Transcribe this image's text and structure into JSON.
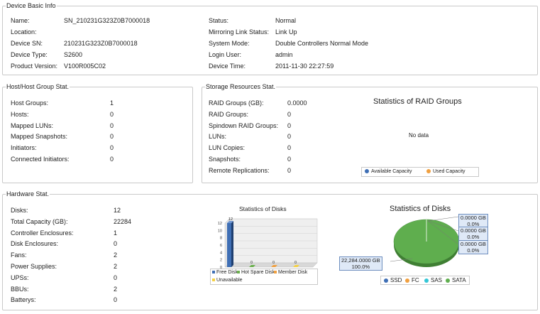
{
  "basic": {
    "legend": "Device Basic Info",
    "left": [
      {
        "label": "Name:",
        "value": "SN_210231G323Z0B7000018"
      },
      {
        "label": "Location:",
        "value": ""
      },
      {
        "label": "Device SN:",
        "value": "210231G323Z0B7000018"
      },
      {
        "label": "Device Type:",
        "value": "S2600"
      },
      {
        "label": "Product Version:",
        "value": "V100R005C02"
      }
    ],
    "right": [
      {
        "label": "Status:",
        "value": "Normal"
      },
      {
        "label": "Mirroring Link Status:",
        "value": "Link Up"
      },
      {
        "label": "System Mode:",
        "value": "Double Controllers Normal Mode"
      },
      {
        "label": "Login User:",
        "value": "admin"
      },
      {
        "label": "Device Time:",
        "value": "2011-11-30 22:27:59"
      }
    ]
  },
  "host": {
    "legend": "Host/Host Group Stat.",
    "rows": [
      {
        "label": "Host Groups:",
        "value": "1"
      },
      {
        "label": "Hosts:",
        "value": "0"
      },
      {
        "label": "Mapped LUNs:",
        "value": "0"
      },
      {
        "label": "Mapped Snapshots:",
        "value": "0"
      },
      {
        "label": "Initiators:",
        "value": "0"
      },
      {
        "label": "Connected Initiators:",
        "value": "0"
      }
    ]
  },
  "storage": {
    "legend": "Storage Resources Stat.",
    "rows": [
      {
        "label": "RAID Groups (GB):",
        "value": "0.0000"
      },
      {
        "label": "RAID Groups:",
        "value": "0"
      },
      {
        "label": "Spindown RAID Groups:",
        "value": "0"
      },
      {
        "label": "LUNs:",
        "value": "0"
      },
      {
        "label": "LUN Copies:",
        "value": "0"
      },
      {
        "label": "Snapshots:",
        "value": "0"
      },
      {
        "label": "Remote Replications:",
        "value": "0"
      }
    ],
    "raid_chart_title": "Statistics of RAID Groups",
    "raid_no_data": "No data",
    "raid_legend": [
      {
        "name": "Available Capacity",
        "color": "#3f6fb5"
      },
      {
        "name": "Used Capacity",
        "color": "#f0a040"
      }
    ]
  },
  "hardware": {
    "legend": "Hardware Stat.",
    "rows": [
      {
        "label": "Disks:",
        "value": "12"
      },
      {
        "label": "Total Capacity (GB):",
        "value": "22284"
      },
      {
        "label": "Controller Enclosures:",
        "value": "1"
      },
      {
        "label": "Disk Enclosures:",
        "value": "0"
      },
      {
        "label": "Fans:",
        "value": "2"
      },
      {
        "label": "Power Supplies:",
        "value": "2"
      },
      {
        "label": "UPSs:",
        "value": "0"
      },
      {
        "label": "BBUs:",
        "value": "2"
      },
      {
        "label": "Batterys:",
        "value": "0"
      }
    ]
  },
  "chart_data": [
    {
      "type": "bar",
      "title": "Statistics of Disks",
      "categories": [
        "Free Disk",
        "Hot Spare Disk",
        "Member Disk",
        "Unavailable"
      ],
      "values": [
        12,
        0,
        0,
        0
      ],
      "value_labels": [
        "12",
        "0",
        "0",
        "0"
      ],
      "colors": [
        "#3f6fb5",
        "#6ab04c",
        "#f0a040",
        "#f5d142"
      ],
      "y_ticks": [
        "12",
        "10",
        "8",
        "6",
        "4",
        "2",
        "0"
      ],
      "ylim": [
        0,
        12
      ],
      "legend_rows": [
        [
          "Free Disk",
          "Hot Spare Disk",
          "Member Disk"
        ],
        [
          "Unavailable"
        ]
      ]
    },
    {
      "type": "pie",
      "title": "Statistics of Disks",
      "categories": [
        "SSD",
        "FC",
        "SAS",
        "SATA"
      ],
      "values": [
        0,
        0,
        0,
        22284
      ],
      "colors": [
        "#3f6fb5",
        "#f0a040",
        "#34c6d6",
        "#5fae4e"
      ],
      "callouts": [
        {
          "gb": "0.0000 GB",
          "pct": "0.0%"
        },
        {
          "gb": "0.0000 GB",
          "pct": "0.0%"
        },
        {
          "gb": "0.0000 GB",
          "pct": "0.0%"
        },
        {
          "gb": "22,284.0000 GB",
          "pct": "100.0%"
        }
      ]
    }
  ]
}
